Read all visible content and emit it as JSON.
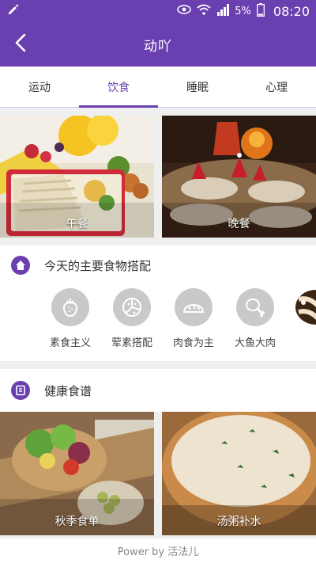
{
  "status": {
    "battery": "5%",
    "time": "08:20",
    "icons": [
      "edit-icon",
      "eye-icon",
      "wifi-icon",
      "signal-icon",
      "battery-icon"
    ]
  },
  "header": {
    "title": "动吖",
    "back_icon": "chevron-left-icon"
  },
  "tabs": [
    {
      "label": "运动"
    },
    {
      "label": "饮食",
      "active": true
    },
    {
      "label": "睡眠"
    },
    {
      "label": "心理"
    }
  ],
  "meals": [
    {
      "label": "午餐"
    },
    {
      "label": "晚餐"
    }
  ],
  "main_food": {
    "title": "今天的主要食物搭配",
    "icon": "home-icon",
    "items": [
      {
        "label": "素食主义",
        "icon": "strawberry-icon"
      },
      {
        "label": "荤素搭配",
        "icon": "pizza-icon"
      },
      {
        "label": "肉食为主",
        "icon": "bread-icon"
      },
      {
        "label": "大鱼大肉",
        "icon": "drumstick-icon"
      }
    ]
  },
  "recipes": {
    "title": "健康食谱",
    "icon": "recipe-book-icon",
    "items": [
      {
        "label": "秋季食单"
      },
      {
        "label": "汤粥补水"
      }
    ]
  },
  "footer": {
    "text": "Power by 活法儿"
  },
  "colors": {
    "accent": "#6a3fb0",
    "icon_circle": "#c9c9c9"
  }
}
